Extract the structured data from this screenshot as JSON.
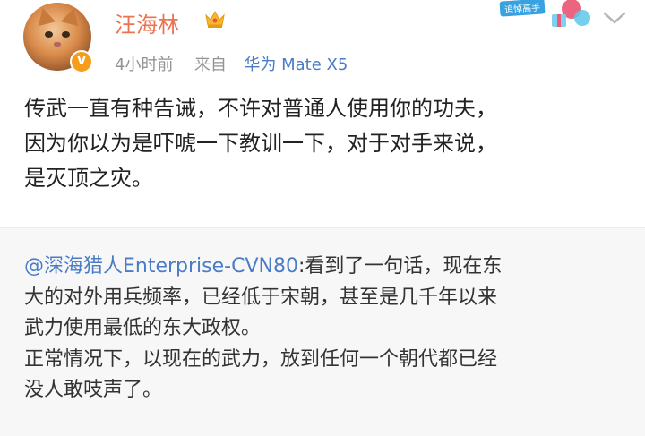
{
  "post": {
    "author": "汪海林",
    "time": "4小时前",
    "source_prefix": "来自",
    "device": "华为 Mate X5",
    "badge_text": "V",
    "promo_text": "追悼高手",
    "text_lines": [
      "传武一直有种告诫，不许对普通人使用你的功夫，",
      "因为你以为是吓唬一下教训一下，对于对手来说，",
      "是灭顶之灾。"
    ]
  },
  "repost": {
    "mention": "@深海猎人Enterprise-CVN80",
    "lines": [
      ":看到了一句话，现在东",
      "大的对外用兵频率，已经低于宋朝，甚至是几千年以来",
      "武力使用最低的东大政权。",
      "正常情况下，以现在的武力，放到任何一个朝代都已经",
      "没人敢吱声了。"
    ]
  },
  "colors": {
    "username": "#eb7350",
    "link": "#4a7cc7",
    "meta": "#939393",
    "repost_bg": "#f7f7f7"
  }
}
